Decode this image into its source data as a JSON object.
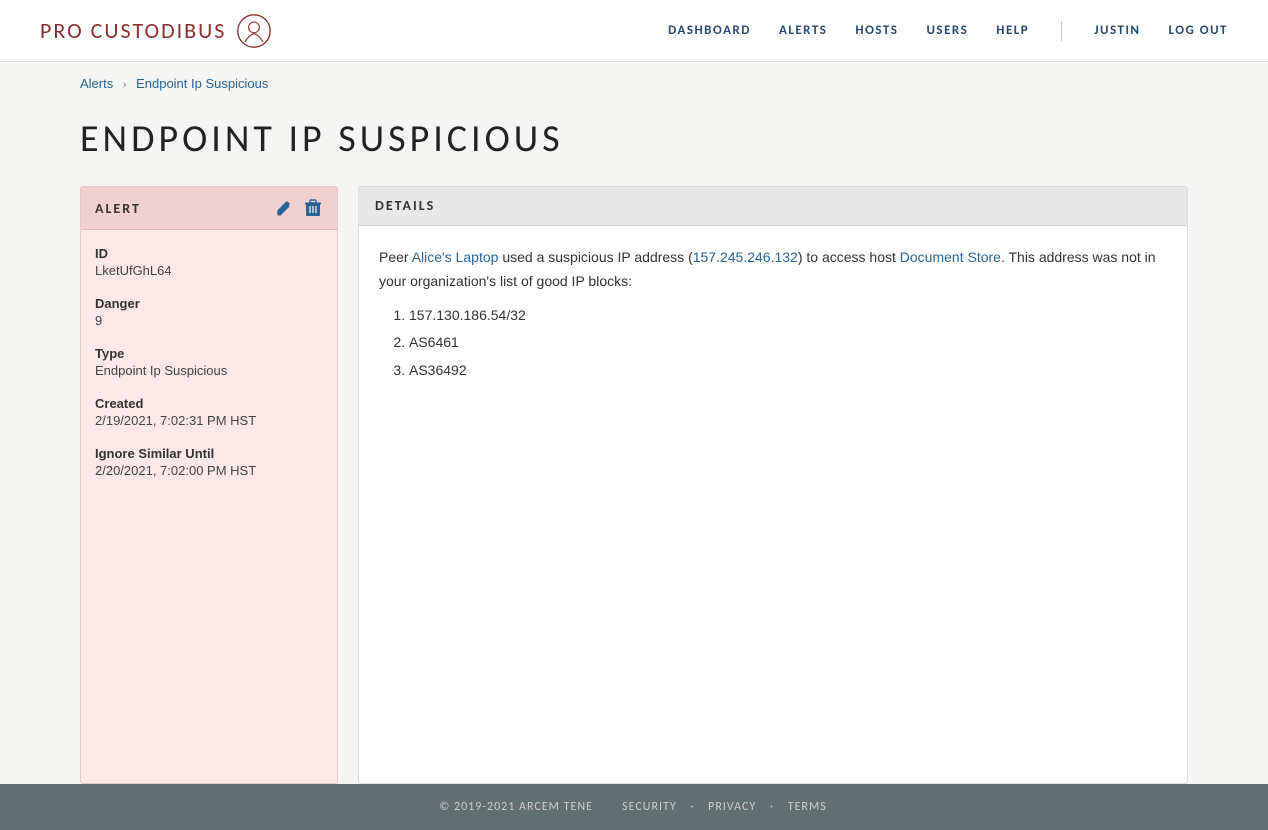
{
  "brand": {
    "name": "PRO CUSTODIBUS",
    "logo_alt": "pro-custodibus-logo"
  },
  "nav": {
    "items": [
      {
        "label": "DASHBOARD",
        "id": "dashboard"
      },
      {
        "label": "ALERTS",
        "id": "alerts"
      },
      {
        "label": "HOSTS",
        "id": "hosts"
      },
      {
        "label": "USERS",
        "id": "users"
      },
      {
        "label": "HELP",
        "id": "help"
      }
    ],
    "user": "JUSTIN",
    "logout": "LOG OUT"
  },
  "breadcrumb": {
    "parent": "Alerts",
    "current": "Endpoint Ip Suspicious"
  },
  "page_title": "ENDPOINT IP SUSPICIOUS",
  "alert_card": {
    "header": "ALERT",
    "edit_label": "edit",
    "delete_label": "delete",
    "fields": [
      {
        "label": "ID",
        "value": "LketUfGhL64"
      },
      {
        "label": "Danger",
        "value": "9"
      },
      {
        "label": "Type",
        "value": "Endpoint Ip Suspicious"
      },
      {
        "label": "Created",
        "value": "2/19/2021, 7:02:31 PM HST"
      },
      {
        "label": "Ignore Similar Until",
        "value": "2/20/2021, 7:02:00 PM HST"
      }
    ]
  },
  "details_card": {
    "header": "DETAILS",
    "description_prefix": "Peer ",
    "peer_name": "Alice's Laptop",
    "description_middle": " used a suspicious IP address (",
    "ip_address": "157.245.246.132",
    "description_after_ip": ") to access host ",
    "host_name": "Document Store",
    "description_suffix": ". This address was not in your organization's list of good IP blocks:",
    "list_items": [
      "157.130.186.54/32",
      "AS6461",
      "AS36492"
    ]
  },
  "footer": {
    "copyright": "© 2019-2021 ARCEM TENE",
    "links": [
      {
        "label": "SECURITY"
      },
      {
        "label": "PRIVACY"
      },
      {
        "label": "TERMS"
      }
    ]
  }
}
